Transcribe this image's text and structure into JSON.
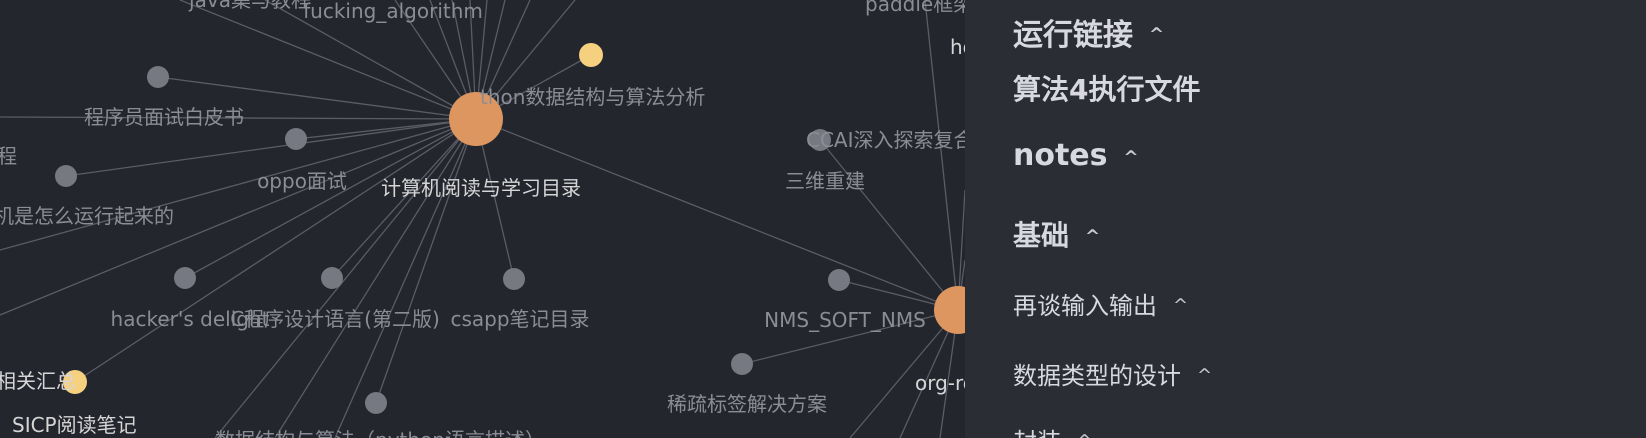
{
  "graph": {
    "nodes": [
      {
        "id": "java",
        "label": "java集与教程"
      },
      {
        "id": "fucking",
        "label": "fucking_algorithm"
      },
      {
        "id": "python",
        "label": "thon数据结构与算法分析"
      },
      {
        "id": "interview",
        "label": "程序员面试白皮书"
      },
      {
        "id": "cheng",
        "label": "程"
      },
      {
        "id": "oppo",
        "label": "oppo面试"
      },
      {
        "id": "center",
        "label": "计算机阅读与学习目录"
      },
      {
        "id": "computer_run",
        "label": "机是怎么运行起来的"
      },
      {
        "id": "hackers",
        "label": "hacker's delight"
      },
      {
        "id": "c_lang",
        "label": "C程序设计语言(第二版)"
      },
      {
        "id": "csapp",
        "label": "csapp笔记目录"
      },
      {
        "id": "summary",
        "label": "相关汇总"
      },
      {
        "id": "sicp",
        "label": "SICP阅读笔记"
      },
      {
        "id": "ds_py",
        "label": "数据结构与算法（python语言描述）"
      },
      {
        "id": "paddle",
        "label": "paddle框架"
      },
      {
        "id": "ho",
        "label": "ho"
      },
      {
        "id": "ccai",
        "label": "CCAI深入探索复合"
      },
      {
        "id": "recon",
        "label": "三维重建"
      },
      {
        "id": "nms",
        "label": "NMS_SOFT_NMS"
      },
      {
        "id": "sparse",
        "label": "稀疏标签解决方案"
      },
      {
        "id": "org",
        "label": "org-ro"
      }
    ],
    "colors": {
      "hub": "#dd9660",
      "leaf": "#767882",
      "highlight": "#f5d07e",
      "edge": "#5a5c66"
    }
  },
  "outline": {
    "items": [
      {
        "label": "运行链接",
        "caret": "^"
      },
      {
        "label": "算法4执行文件"
      },
      {
        "label": "notes",
        "caret": "^"
      },
      {
        "label": "基础",
        "caret": "^"
      },
      {
        "label": "再谈输入输出",
        "caret": "^"
      },
      {
        "label": "数据类型的设计",
        "caret": "^"
      },
      {
        "label": "封装",
        "caret": "^"
      }
    ]
  }
}
